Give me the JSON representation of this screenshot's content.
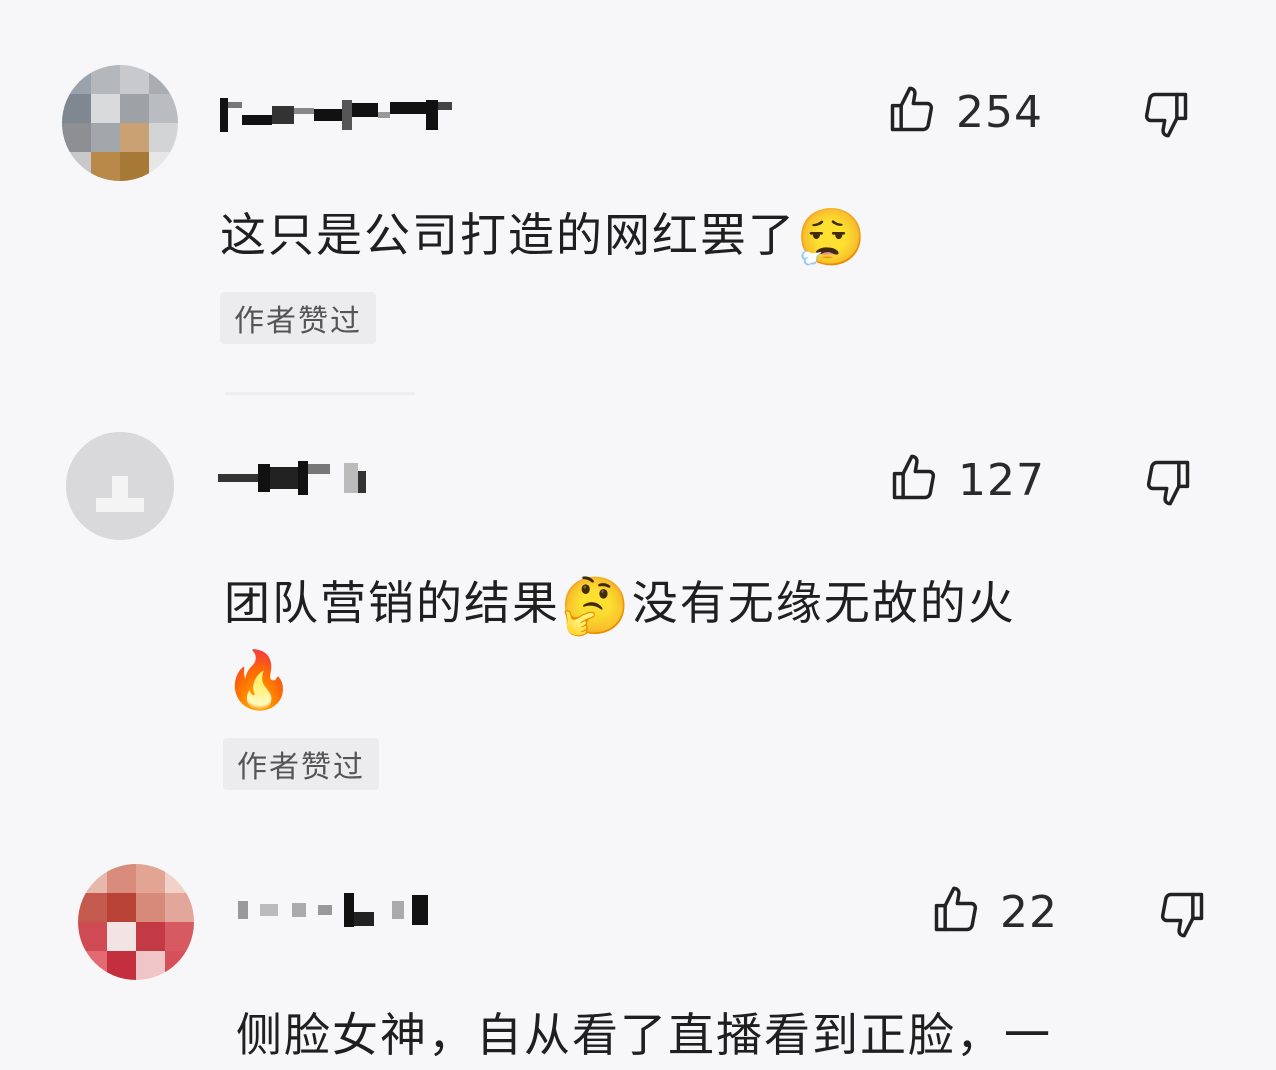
{
  "comments": [
    {
      "likes": "254",
      "text": "这只是公司打造的网红罢了",
      "emoji": "😮‍💨",
      "badge": "作者赞过"
    },
    {
      "likes": "127",
      "text_part1": "团队营销的结果",
      "emoji": "🤔",
      "text_part2": "没有无缘无故的火",
      "emoji2": "🔥",
      "badge": "作者赞过"
    },
    {
      "likes": "22",
      "text": "侧脸女神，自从看了直播看到正脸，一"
    }
  ],
  "icons": {
    "like": "thumbs-up-icon",
    "dislike": "thumbs-down-icon"
  }
}
